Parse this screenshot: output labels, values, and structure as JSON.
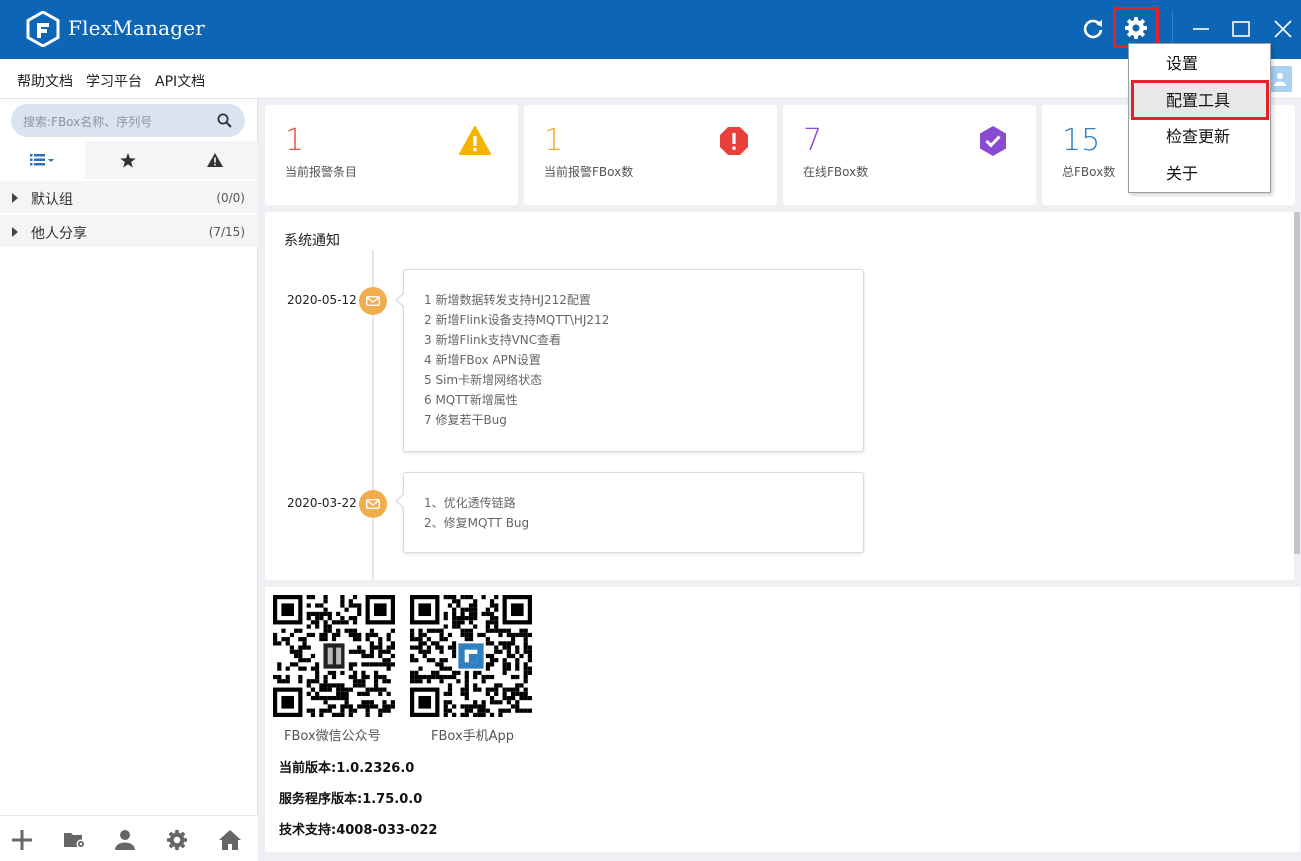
{
  "app": {
    "title": "FlexManager",
    "brand_color": "#0d66b5"
  },
  "titlebar": {
    "icons": [
      "refresh-icon",
      "gear-icon",
      "minimize-icon",
      "maximize-icon",
      "close-icon"
    ]
  },
  "menubar": {
    "items": [
      "帮助文档",
      "学习平台",
      "API文档"
    ]
  },
  "sidebar": {
    "search_placeholder": "搜索:FBox名称、序列号",
    "tabs": [
      "list-icon",
      "star-icon",
      "warning-icon"
    ],
    "groups": [
      {
        "name": "默认组",
        "count": "(0/0)"
      },
      {
        "name": "他人分享",
        "count": "(7/15)"
      }
    ],
    "bottom_icons": [
      "add-icon",
      "folder-settings-icon",
      "user-icon",
      "settings-icon",
      "home-icon"
    ]
  },
  "stats": [
    {
      "value": "1",
      "label": "当前报警条目",
      "color": "#e8523e",
      "icon": "warning-triangle-icon"
    },
    {
      "value": "1",
      "label": "当前报警FBox数",
      "color": "#f0a928",
      "icon": "alert-octagon-icon"
    },
    {
      "value": "7",
      "label": "在线FBox数",
      "color": "#8a4bd3",
      "icon": "verified-check-icon"
    },
    {
      "value": "15",
      "label": "总FBox数",
      "color": "#2f7fc1",
      "icon": ""
    }
  ],
  "notice": {
    "title": "系统通知",
    "entries": [
      {
        "date": "2020-05-12",
        "lines": [
          "1 新增数据转发支持HJ212配置",
          "2 新增Flink设备支持MQTT\\HJ212",
          "3 新增Flink支持VNC查看",
          "4 新增FBox APN设置",
          "5 Sim卡新增网络状态",
          "6 MQTT新增属性",
          "7 修复若干Bug"
        ]
      },
      {
        "date": "2020-03-22",
        "lines": [
          "1、优化透传链路",
          "2、修复MQTT Bug"
        ]
      }
    ]
  },
  "info": {
    "qr_captions": [
      "FBox微信公众号",
      "FBox手机App"
    ],
    "version": "当前版本:1.0.2326.0",
    "service_version": "服务程序版本:1.75.0.0",
    "support": "技术支持:4008-033-022"
  },
  "dropdown": {
    "items": [
      "设置",
      "配置工具",
      "检查更新",
      "关于"
    ],
    "highlighted": "配置工具"
  }
}
